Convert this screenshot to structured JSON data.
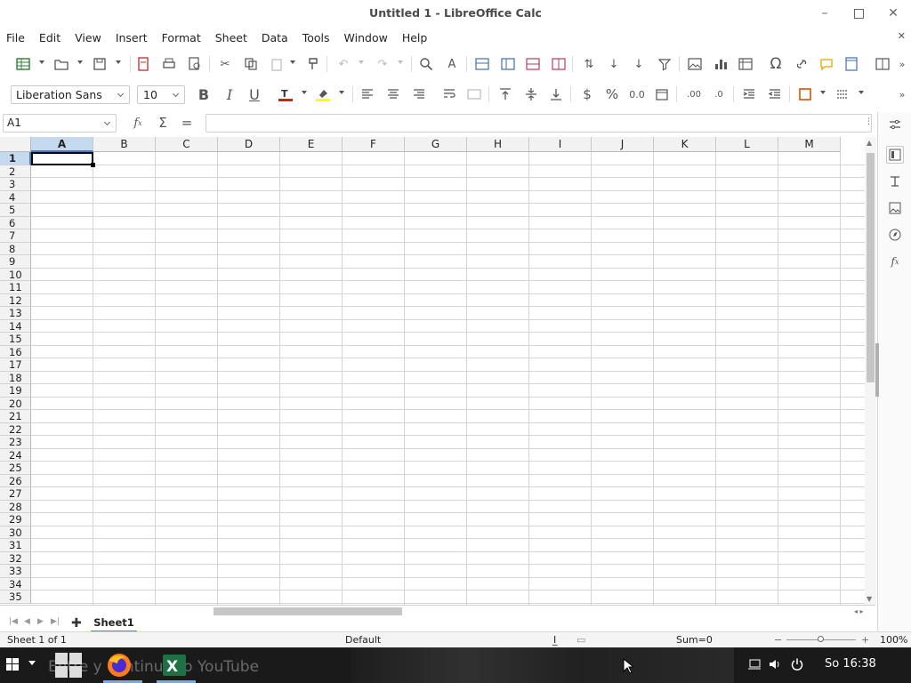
{
  "window": {
    "title": "Untitled 1 - LibreOffice Calc"
  },
  "menu": [
    "File",
    "Edit",
    "View",
    "Insert",
    "Format",
    "Sheet",
    "Data",
    "Tools",
    "Window",
    "Help"
  ],
  "format": {
    "font_name": "Liberation Sans",
    "font_size": "10"
  },
  "formula_bar": {
    "cell_ref": "A1",
    "formula": ""
  },
  "grid": {
    "columns": [
      "A",
      "B",
      "C",
      "D",
      "E",
      "F",
      "G",
      "H",
      "I",
      "J",
      "K",
      "L",
      "M"
    ],
    "rows": [
      "1",
      "2",
      "3",
      "4",
      "5",
      "6",
      "7",
      "8",
      "9",
      "10",
      "11",
      "12",
      "13",
      "14",
      "15",
      "16",
      "17",
      "18",
      "19",
      "20",
      "21",
      "22",
      "23",
      "24",
      "25",
      "26",
      "27",
      "28",
      "29",
      "30",
      "31",
      "32",
      "33",
      "34",
      "35"
    ],
    "selected_cell": "A1"
  },
  "sheets": {
    "tabs": [
      "Sheet1"
    ],
    "active": "Sheet1"
  },
  "status": {
    "sheet_info": "Sheet 1 of 1",
    "page_style": "Default",
    "sum": "Sum=0",
    "zoom": "100%"
  },
  "taskbar": {
    "overlay_text": "Entre y continue to YouTube",
    "clock": "So 16:38"
  },
  "colors": {
    "selection_header": "#c5d9ef",
    "selection_accent": "#3f7bc1",
    "excel_green": "#1e7145",
    "font_color_accent": "#c9211e",
    "highlight_accent": "#ffff00"
  }
}
